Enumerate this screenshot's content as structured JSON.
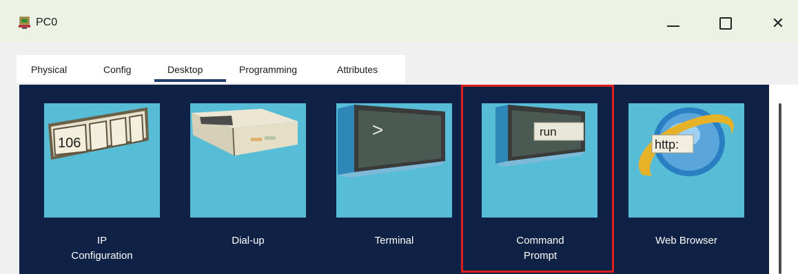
{
  "window": {
    "title": "PC0",
    "icon": "pc-icon",
    "controls": {
      "minimize": "minimize-icon",
      "maximize": "maximize-icon",
      "close": "close-icon"
    }
  },
  "tabs": [
    {
      "label": "Physical",
      "selected": false
    },
    {
      "label": "Config",
      "selected": false
    },
    {
      "label": "Desktop",
      "selected": true
    },
    {
      "label": "Programming",
      "selected": false
    },
    {
      "label": "Attributes",
      "selected": false
    }
  ],
  "desktop": {
    "apps": [
      {
        "label": "IP\nConfiguration",
        "icon": "ip-configuration-icon",
        "icon_text": "106"
      },
      {
        "label": "Dial-up",
        "icon": "dial-up-modem-icon"
      },
      {
        "label": "Terminal",
        "icon": "terminal-icon",
        "icon_text": ">"
      },
      {
        "label": "Command\nPrompt",
        "icon": "command-prompt-icon",
        "icon_text": "run",
        "highlighted": true
      },
      {
        "label": "Web Browser",
        "icon": "web-browser-icon",
        "icon_text": "http:"
      }
    ]
  },
  "colors": {
    "titlebar": "#ecf3e4",
    "desktop_background": "#0f2246",
    "tile": "#57bdd6",
    "highlight": "#e01e1e",
    "selected_tab_underline": "#1f3e6b"
  }
}
